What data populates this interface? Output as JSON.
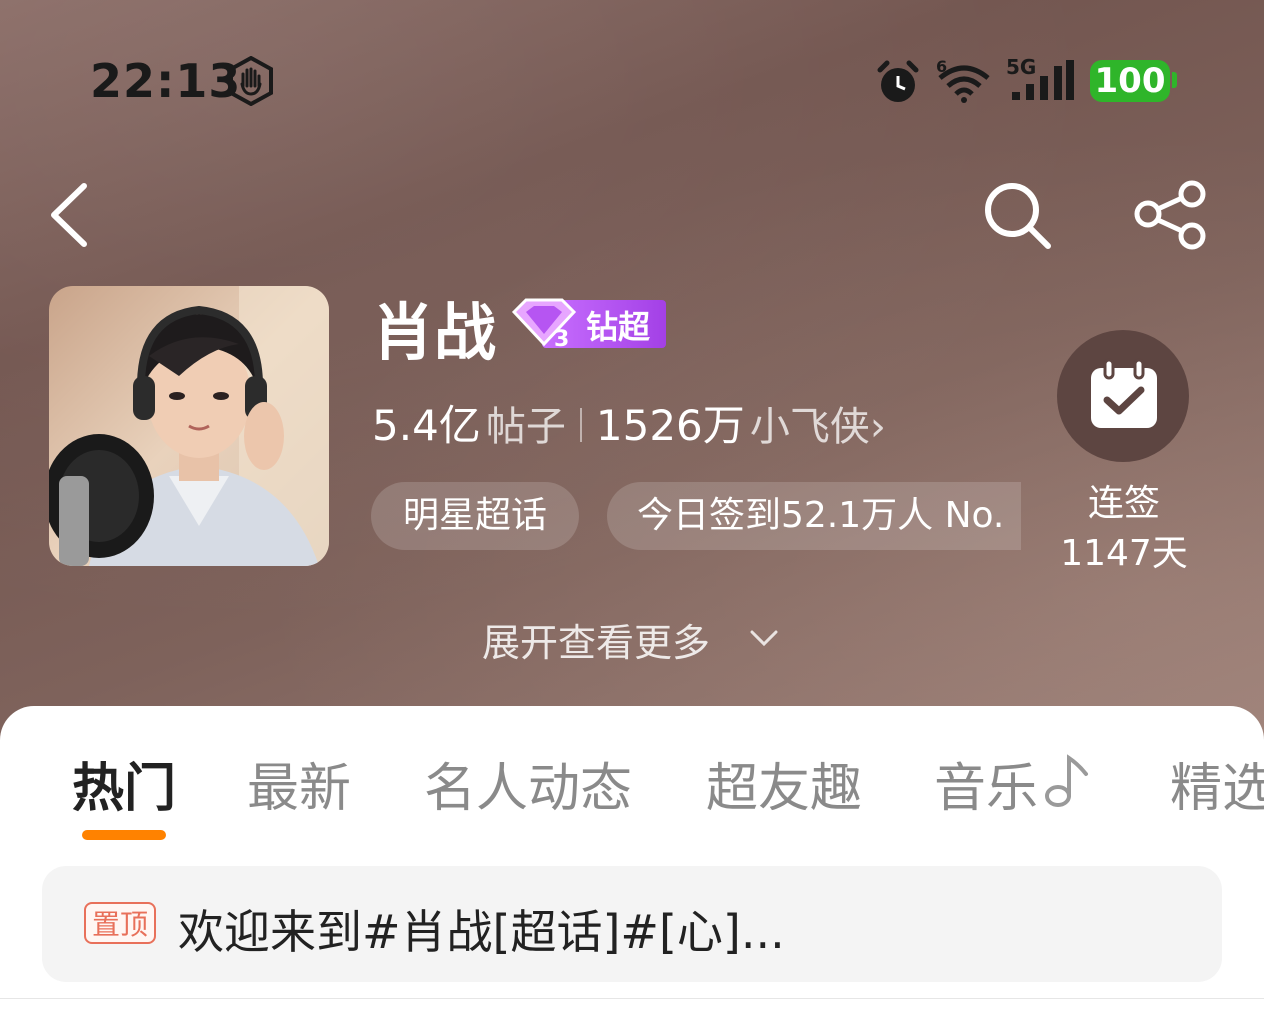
{
  "status_bar": {
    "time": "22:13",
    "battery": "100",
    "network": "5G",
    "wifi_label": "6"
  },
  "topic": {
    "name": "肖战",
    "badge_level": "3",
    "badge_label": "钻超",
    "posts_count": "5.4亿",
    "posts_unit": "帖子",
    "fans_count": "1526万",
    "fans_unit": "小飞侠",
    "fans_chevron": "›",
    "category_tag": "明星超话",
    "checkin_status": "今日签到52.1万人 No."
  },
  "checkin": {
    "label": "连签",
    "days": "1147天"
  },
  "expand_label": "展开查看更多",
  "tabs": [
    {
      "label": "热门",
      "active": true
    },
    {
      "label": "最新"
    },
    {
      "label": "名人动态"
    },
    {
      "label": "超友趣"
    },
    {
      "label": "音乐"
    },
    {
      "label": "精选"
    }
  ],
  "pinned": {
    "badge": "置顶",
    "text": "欢迎来到#肖战[超话]#[心]..."
  },
  "colors": {
    "accent": "#ff8200",
    "battery": "#2fb52a",
    "badge_purple": "#b25ae6"
  }
}
